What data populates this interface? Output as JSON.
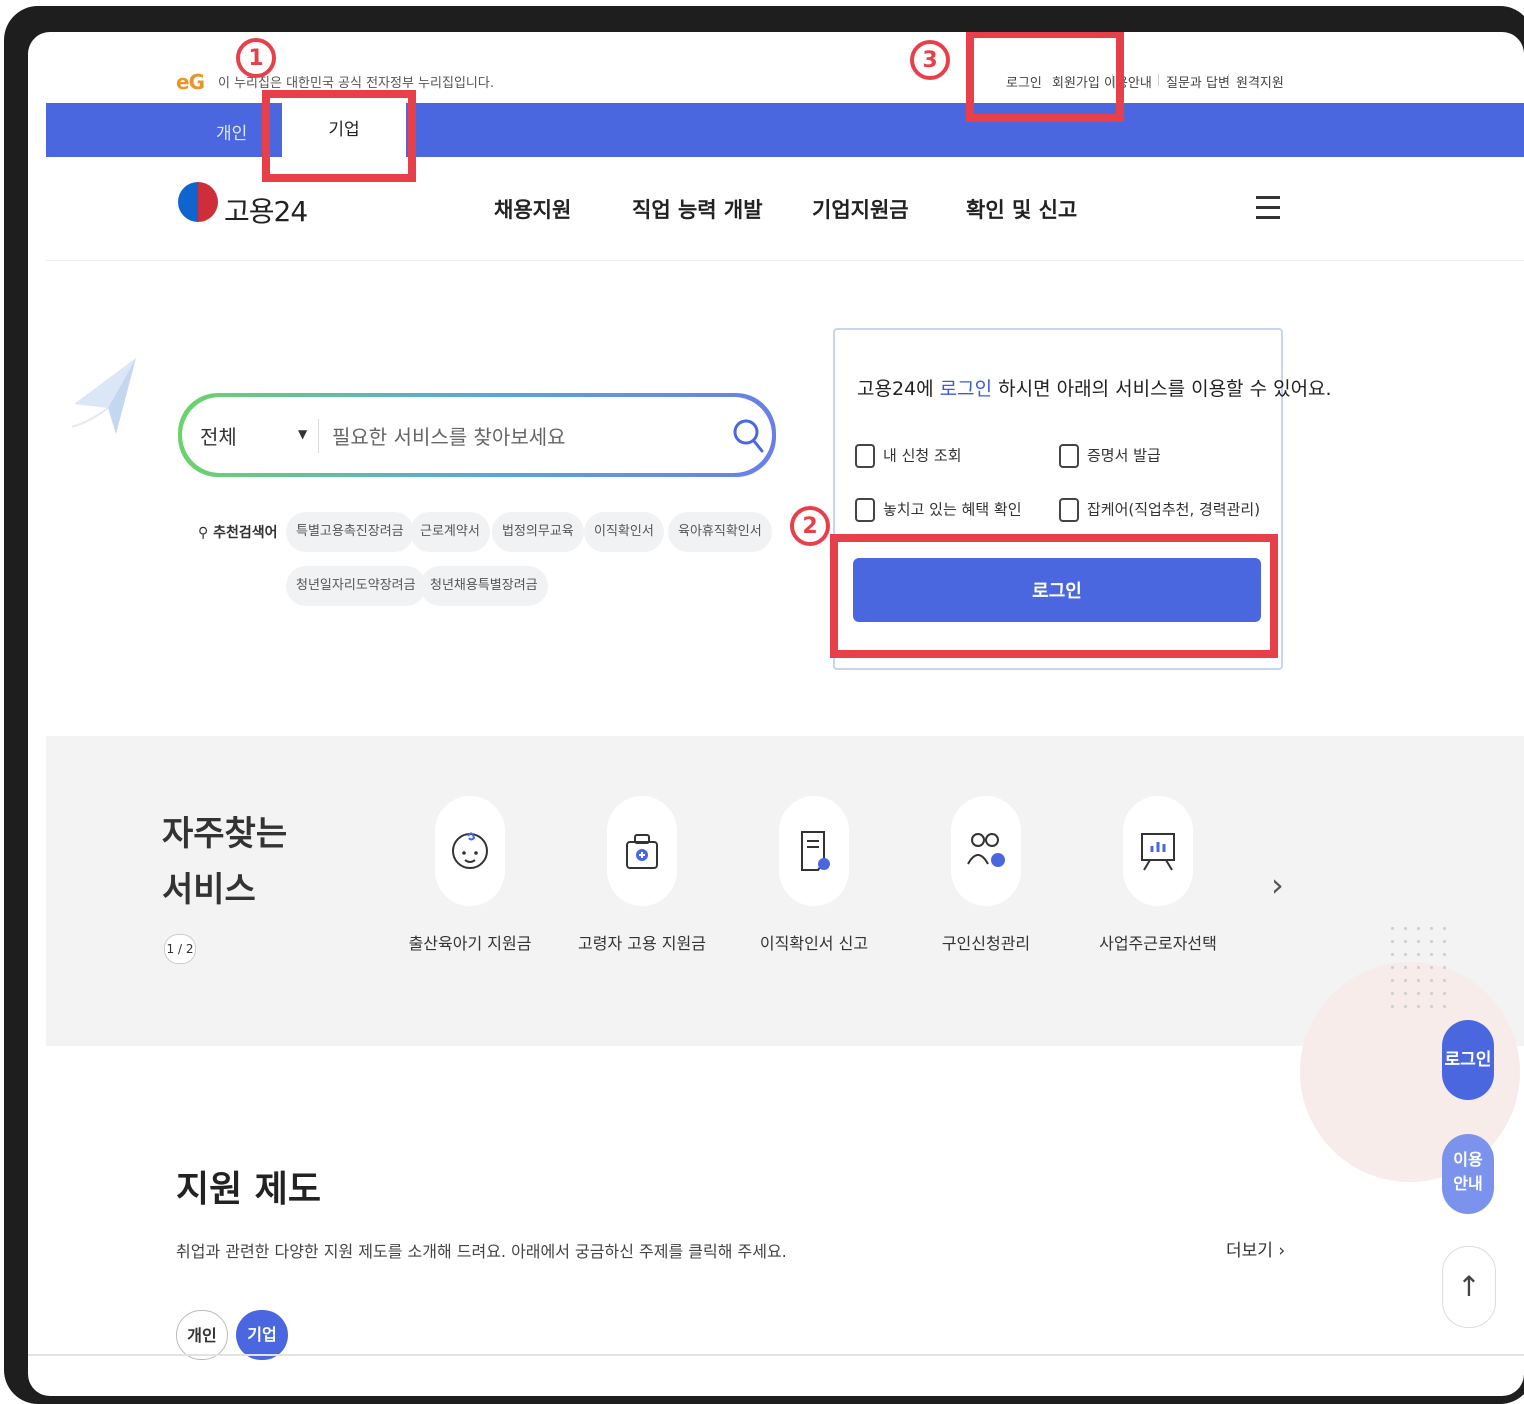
{
  "gov_banner": {
    "logo": "eG",
    "text": "이 누리집은 대한민국 공식 전자정부 누리집입니다."
  },
  "util_links": [
    "로그인",
    "회원가입",
    "이용안내",
    "질문과 답변",
    "원격지원"
  ],
  "audience_tabs": {
    "personal": "개인",
    "corporate": "기업"
  },
  "brand": {
    "name": "고용24"
  },
  "nav": [
    "채용지원",
    "직업 능력 개발",
    "기업지원금",
    "확인 및 신고"
  ],
  "search": {
    "scope": "전체",
    "placeholder": "필요한 서비스를 찾아보세요"
  },
  "recommended": {
    "label": "추천검색어",
    "keywords": [
      "특별고용촉진장려금",
      "근로계약서",
      "법정의무교육",
      "이직확인서",
      "육아휴직확인서",
      "청년일자리도약장려금",
      "청년채용특별장려금"
    ]
  },
  "login_box": {
    "title_prefix": "고용24에",
    "title_link": "로그인",
    "title_suffix": "하시면 아래의 서비스를 이용할 수 있어요.",
    "services": [
      "내 신청 조회",
      "증명서 발급",
      "놓치고 있는 혜택 확인",
      "잡케어(직업추천, 경력관리)"
    ],
    "button": "로그인"
  },
  "frequent": {
    "title_line1": "자주찾는",
    "title_line2": "서비스",
    "pager": "1 / 2",
    "items": [
      {
        "label": "출산육아기 지원금",
        "icon": "baby-icon"
      },
      {
        "label": "고령자 고용 지원금",
        "icon": "medical-bag-icon"
      },
      {
        "label": "이직확인서 신고",
        "icon": "certificate-icon"
      },
      {
        "label": "구인신청관리",
        "icon": "people-check-icon"
      },
      {
        "label": "사업주근로자선택",
        "icon": "presentation-board-icon"
      }
    ]
  },
  "floating": {
    "login": "로그인",
    "guide_line1": "이용",
    "guide_line2": "안내",
    "top": "↑"
  },
  "support": {
    "title": "지원 제도",
    "desc": "취업과 관련한 다양한 지원 제도를 소개해 드려요. 아래에서 궁금하신 주제를 클릭해 주세요.",
    "more": "더보기 ›",
    "tabs": [
      "개인",
      "기업"
    ]
  },
  "annotations": [
    "1",
    "2",
    "3"
  ],
  "colors": {
    "primary": "#4a67e0",
    "highlight": "#e8404a",
    "frame": "#1e1e1e"
  }
}
